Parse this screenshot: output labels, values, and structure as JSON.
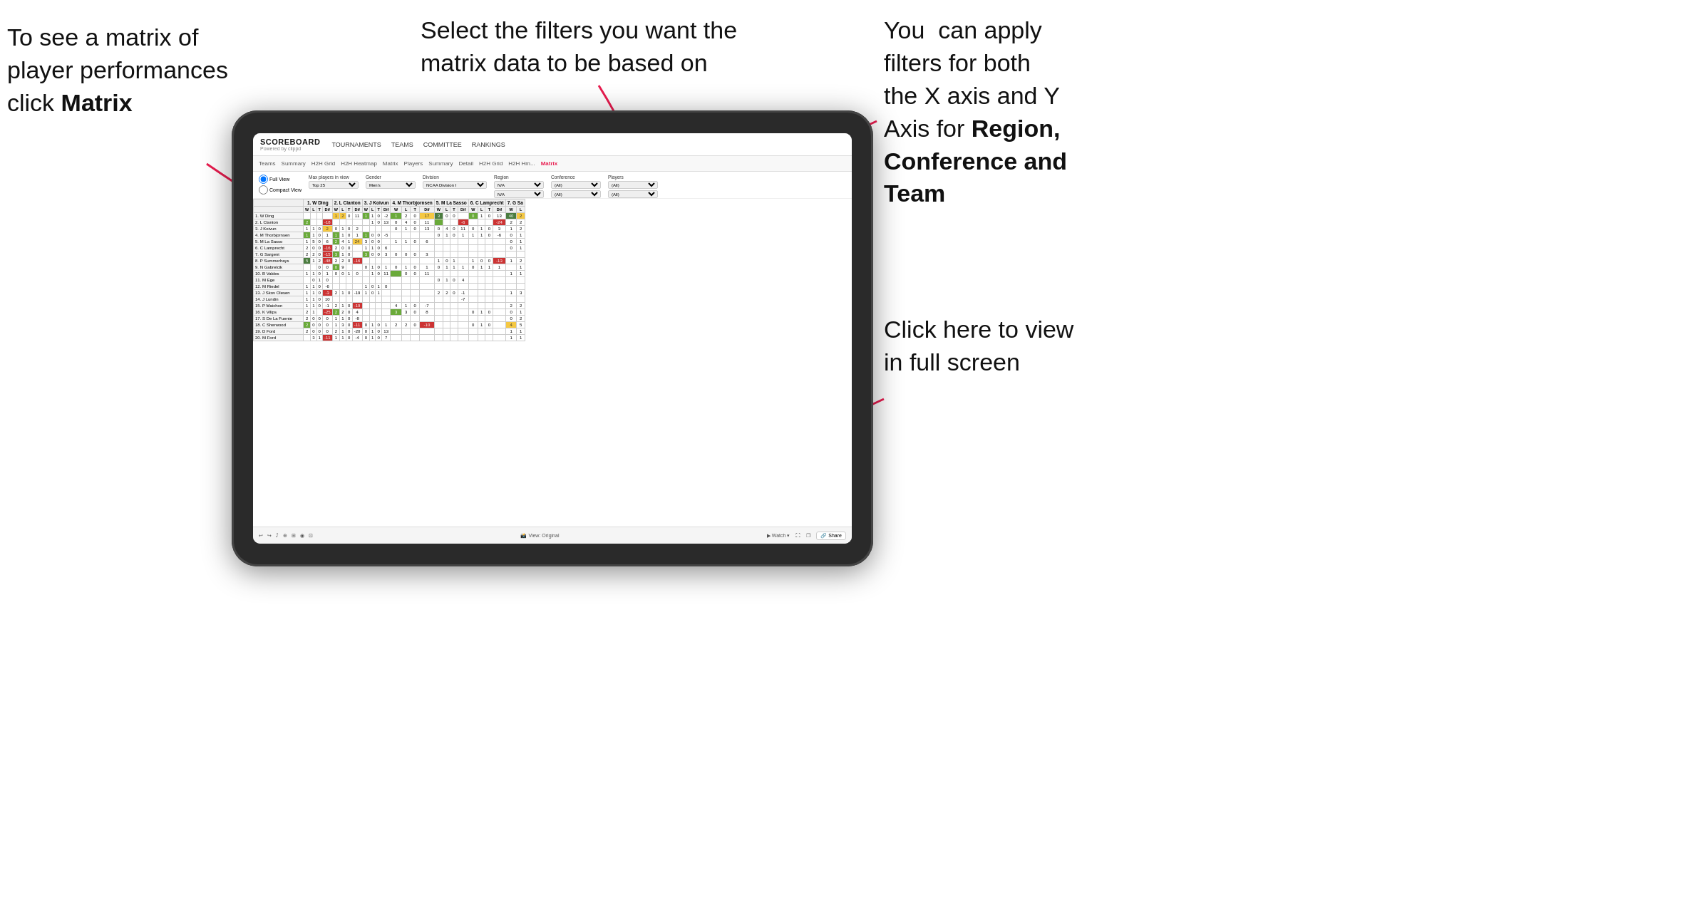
{
  "annotations": {
    "topleft": {
      "line1": "To see a matrix of",
      "line2": "player performances",
      "line3_normal": "click ",
      "line3_bold": "Matrix"
    },
    "topmid": {
      "text": "Select the filters you want the matrix data to be based on"
    },
    "topright": {
      "line1": "You  can apply",
      "line2": "filters for both",
      "line3": "the X axis and Y",
      "line4_normal": "Axis for ",
      "line4_bold": "Region,",
      "line5_bold": "Conference and",
      "line6_bold": "Team"
    },
    "bottomright": {
      "line1": "Click here to view",
      "line2": "in full screen"
    }
  },
  "app": {
    "brand": "SCOREBOARD",
    "brand_sub": "Powered by clippd",
    "nav": [
      "TOURNAMENTS",
      "TEAMS",
      "COMMITTEE",
      "RANKINGS"
    ],
    "sub_tabs": [
      "Teams",
      "Summary",
      "H2H Grid",
      "H2H Heatmap",
      "Matrix",
      "Players",
      "Summary",
      "Detail",
      "H2H Grid",
      "H2H Hm...",
      "Matrix"
    ],
    "active_tab": "Matrix",
    "filters": {
      "view_full": "Full View",
      "view_compact": "Compact View",
      "max_players_label": "Max players in view",
      "max_players_value": "Top 25",
      "gender_label": "Gender",
      "gender_value": "Men's",
      "division_label": "Division",
      "division_value": "NCAA Division I",
      "region_label": "Region",
      "region_value1": "N/A",
      "region_value2": "N/A",
      "conference_label": "Conference",
      "conference_value1": "(All)",
      "conference_value2": "(All)",
      "players_label": "Players",
      "players_value1": "(All)",
      "players_value2": "(All)"
    },
    "column_headers": [
      "1. W Ding",
      "2. L Clanton",
      "3. J Koivun",
      "4. M Thorbjornsen",
      "5. M La Sasso",
      "6. C Lamprecht",
      "7. G Sa"
    ],
    "sub_cols": [
      "W",
      "L",
      "T",
      "Dif"
    ],
    "row_players": [
      "1. W Ding",
      "2. L Clanton",
      "3. J Koivun",
      "4. M Thorbjornsen",
      "5. M La Sasso",
      "6. C Lamprecht",
      "7. G Sargent",
      "8. P Summerhays",
      "9. N Gabrelcik",
      "10. B Valdes",
      "11. M Ege",
      "12. M Riedel",
      "13. J Skov Olesen",
      "14. J Lundin",
      "15. P Maichon",
      "16. K Vilips",
      "17. S De La Fuente",
      "18. C Sherwood",
      "19. D Ford",
      "20. M Ford"
    ],
    "bottom_bar": {
      "tools": [
        "↩",
        "↪",
        "⤴",
        "⊕",
        "⊞⊟",
        "◉",
        "⊡⊟"
      ],
      "view_label": "View: Original",
      "watch_label": "Watch ▾",
      "share_label": "Share"
    }
  }
}
